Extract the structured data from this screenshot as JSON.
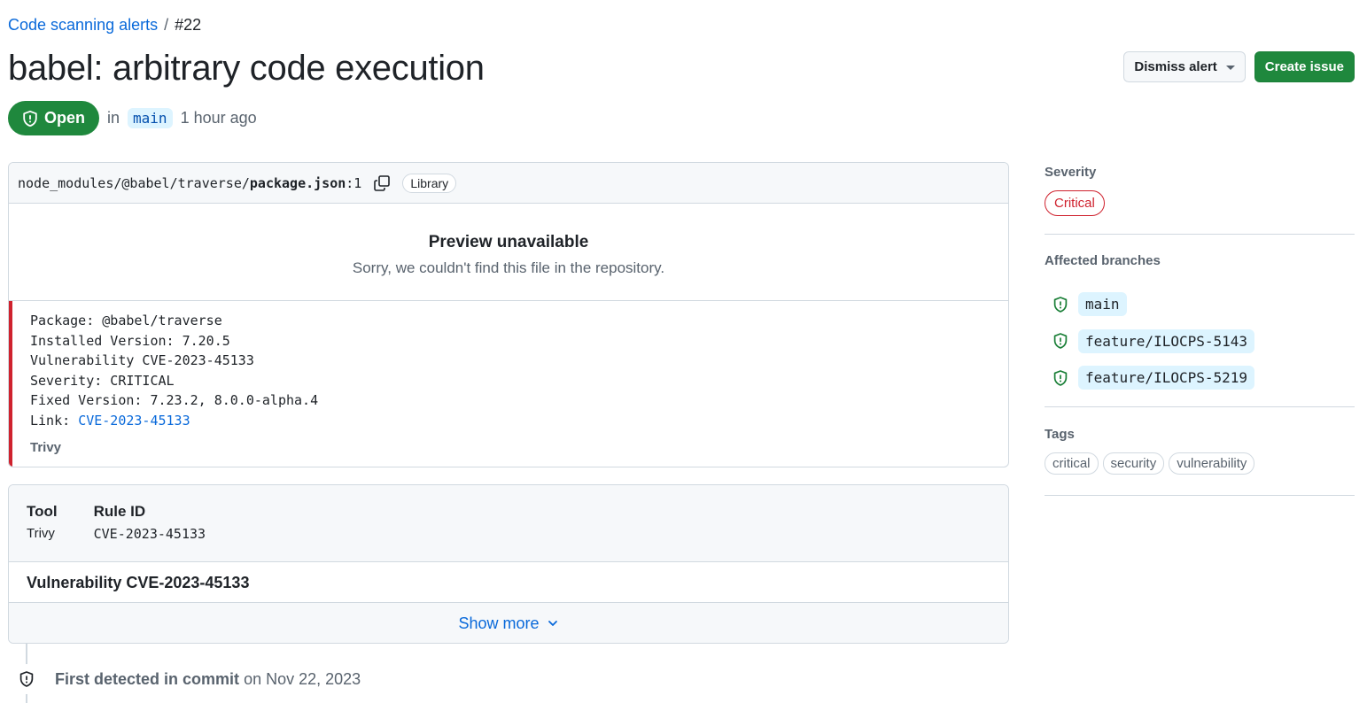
{
  "breadcrumb": {
    "link": "Code scanning alerts",
    "separator": "/",
    "current": "#22"
  },
  "title": "babel: arbitrary code execution",
  "status": {
    "badge": "Open",
    "prefix": "in",
    "branch": "main",
    "time": "1 hour ago"
  },
  "actions": {
    "dismiss": "Dismiss alert",
    "create": "Create issue"
  },
  "file": {
    "path_prefix": "node_modules/@babel/traverse/",
    "path_file": "package.json",
    "path_line": ":1",
    "label": "Library"
  },
  "preview": {
    "title": "Preview unavailable",
    "subtitle": "Sorry, we couldn't find this file in the repository."
  },
  "alert": {
    "line1": "Package: @babel/traverse",
    "line2": "Installed Version: 7.20.5",
    "line3": "Vulnerability CVE-2023-45133",
    "line4": "Severity: CRITICAL",
    "line5": "Fixed Version: 7.23.2, 8.0.0-alpha.4",
    "link_prefix": "Link: ",
    "link_text": "CVE-2023-45133",
    "tool": "Trivy"
  },
  "rule": {
    "tool_header": "Tool",
    "tool_value": "Trivy",
    "rule_header": "Rule ID",
    "rule_value": "CVE-2023-45133",
    "title": "Vulnerability CVE-2023-45133",
    "show_more": "Show more"
  },
  "timeline": {
    "event": "First detected in commit",
    "date": "on Nov 22, 2023"
  },
  "sidebar": {
    "severity_label": "Severity",
    "severity_value": "Critical",
    "branches_label": "Affected branches",
    "branches": [
      "main",
      "feature/ILOCPS-5143",
      "feature/ILOCPS-5219"
    ],
    "tags_label": "Tags",
    "tags": [
      "critical",
      "security",
      "vulnerability"
    ]
  },
  "colors": {
    "accent": "#0969da",
    "success": "#1f883d",
    "danger": "#cf222e",
    "muted": "#59636e",
    "border": "#d1d9e0"
  },
  "icons": {
    "open_badge": "shield-alert-icon",
    "copy": "copy-icon",
    "branch": "shield-alert-icon",
    "show_more": "chevron-down-icon",
    "timeline": "shield-icon"
  }
}
